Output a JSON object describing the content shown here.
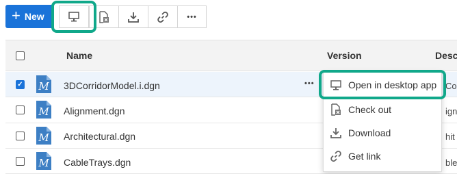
{
  "toolbar": {
    "new_label": "New",
    "more_label": "•••"
  },
  "table": {
    "columns": [
      "Name",
      "Version",
      "Desc"
    ],
    "more_label": "•••",
    "rows": [
      {
        "name": "3DCorridorModel.i.dgn",
        "desc_fragment": "Cor",
        "selected": true
      },
      {
        "name": "Alignment.dgn",
        "desc_fragment": "ignr",
        "selected": false
      },
      {
        "name": "Architectural.dgn",
        "desc_fragment": "hit",
        "selected": false
      },
      {
        "name": "CableTrays.dgn",
        "desc_fragment": "bleT",
        "selected": false
      }
    ]
  },
  "context_menu": {
    "items": [
      {
        "label": "Open in desktop app",
        "icon": "monitor-icon"
      },
      {
        "label": "Check out",
        "icon": "check-out-icon"
      },
      {
        "label": "Download",
        "icon": "download-icon"
      },
      {
        "label": "Get link",
        "icon": "link-icon"
      }
    ]
  },
  "colors": {
    "accent": "#1a73d9",
    "highlight": "#10a88a",
    "file_icon": "#3d7fc4",
    "selected_row": "#edf4fc"
  }
}
